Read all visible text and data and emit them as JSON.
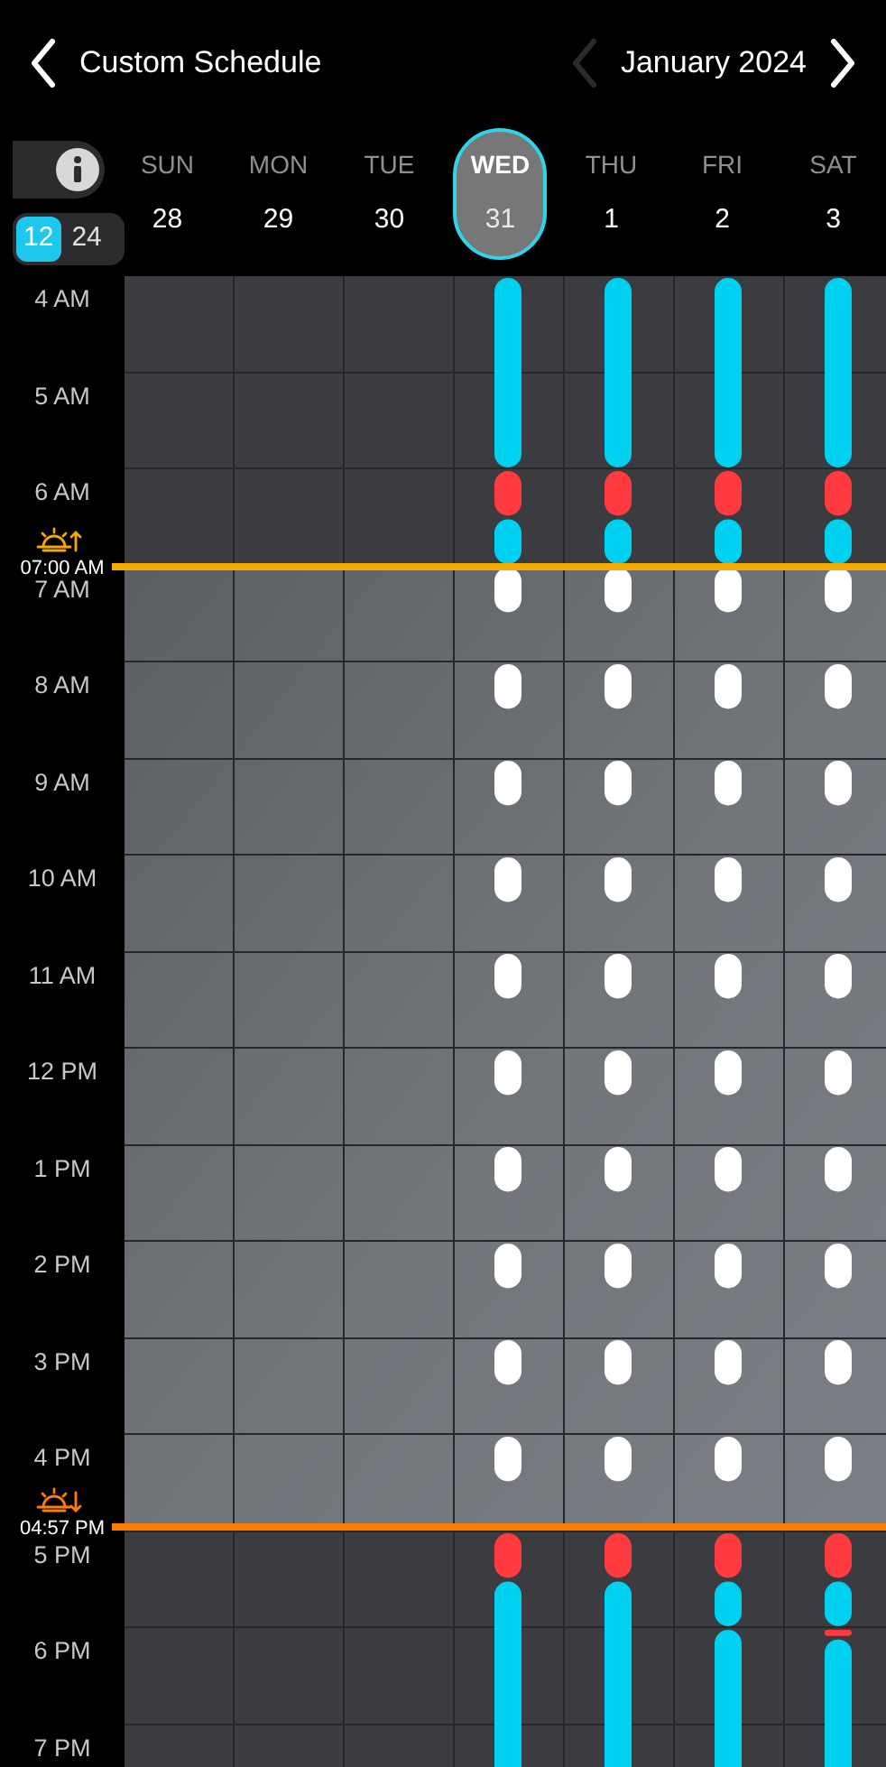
{
  "header": {
    "back_label": "Custom Schedule",
    "month": "January 2024",
    "prev_disabled": true,
    "next_disabled": false
  },
  "clock_format": [
    {
      "label": "12",
      "selected": true
    },
    {
      "label": "24",
      "selected": false
    }
  ],
  "days": [
    {
      "weekday": "SUN",
      "date": "28",
      "selected": false
    },
    {
      "weekday": "MON",
      "date": "29",
      "selected": false
    },
    {
      "weekday": "TUE",
      "date": "30",
      "selected": false
    },
    {
      "weekday": "WED",
      "date": "31",
      "selected": true
    },
    {
      "weekday": "THU",
      "date": "1",
      "selected": false
    },
    {
      "weekday": "FRI",
      "date": "2",
      "selected": false
    },
    {
      "weekday": "SAT",
      "date": "3",
      "selected": false
    }
  ],
  "hours": [
    "4 AM",
    "5 AM",
    "6 AM",
    "7 AM",
    "8 AM",
    "9 AM",
    "10 AM",
    "11 AM",
    "12 PM",
    "1 PM",
    "2 PM",
    "3 PM",
    "4 PM",
    "5 PM",
    "6 PM",
    "7 PM"
  ],
  "sun_events": [
    {
      "kind": "sunrise",
      "time": "07:00 AM",
      "color": "#f5a900"
    },
    {
      "kind": "sunset",
      "time": "04:57 PM",
      "color": "#ff7d00"
    }
  ]
}
